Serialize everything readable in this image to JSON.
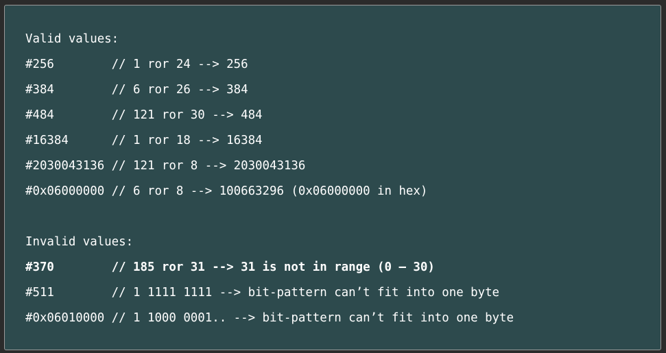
{
  "code_block": {
    "valid_header": "Valid values:",
    "valid_lines": [
      "#256        // 1 ror 24 --> 256",
      "#384        // 6 ror 26 --> 384",
      "#484        // 121 ror 30 --> 484",
      "#16384      // 1 ror 18 --> 16384",
      "#2030043136 // 121 ror 8 --> 2030043136",
      "#0x06000000 // 6 ror 8 --> 100663296 (0x06000000 in hex)"
    ],
    "invalid_header": "Invalid values:",
    "invalid_lines": [
      "#370        // 185 ror 31 --> 31 is not in range (0 – 30)",
      "#511        // 1 1111 1111 --> bit-pattern can’t fit into one byte",
      "#0x06010000 // 1 1000 0001.. --> bit-pattern can’t fit into one byte"
    ]
  },
  "colors": {
    "page_background": "#2b2b2b",
    "panel_background": "#2d4a4d",
    "text": "#ffffff"
  }
}
